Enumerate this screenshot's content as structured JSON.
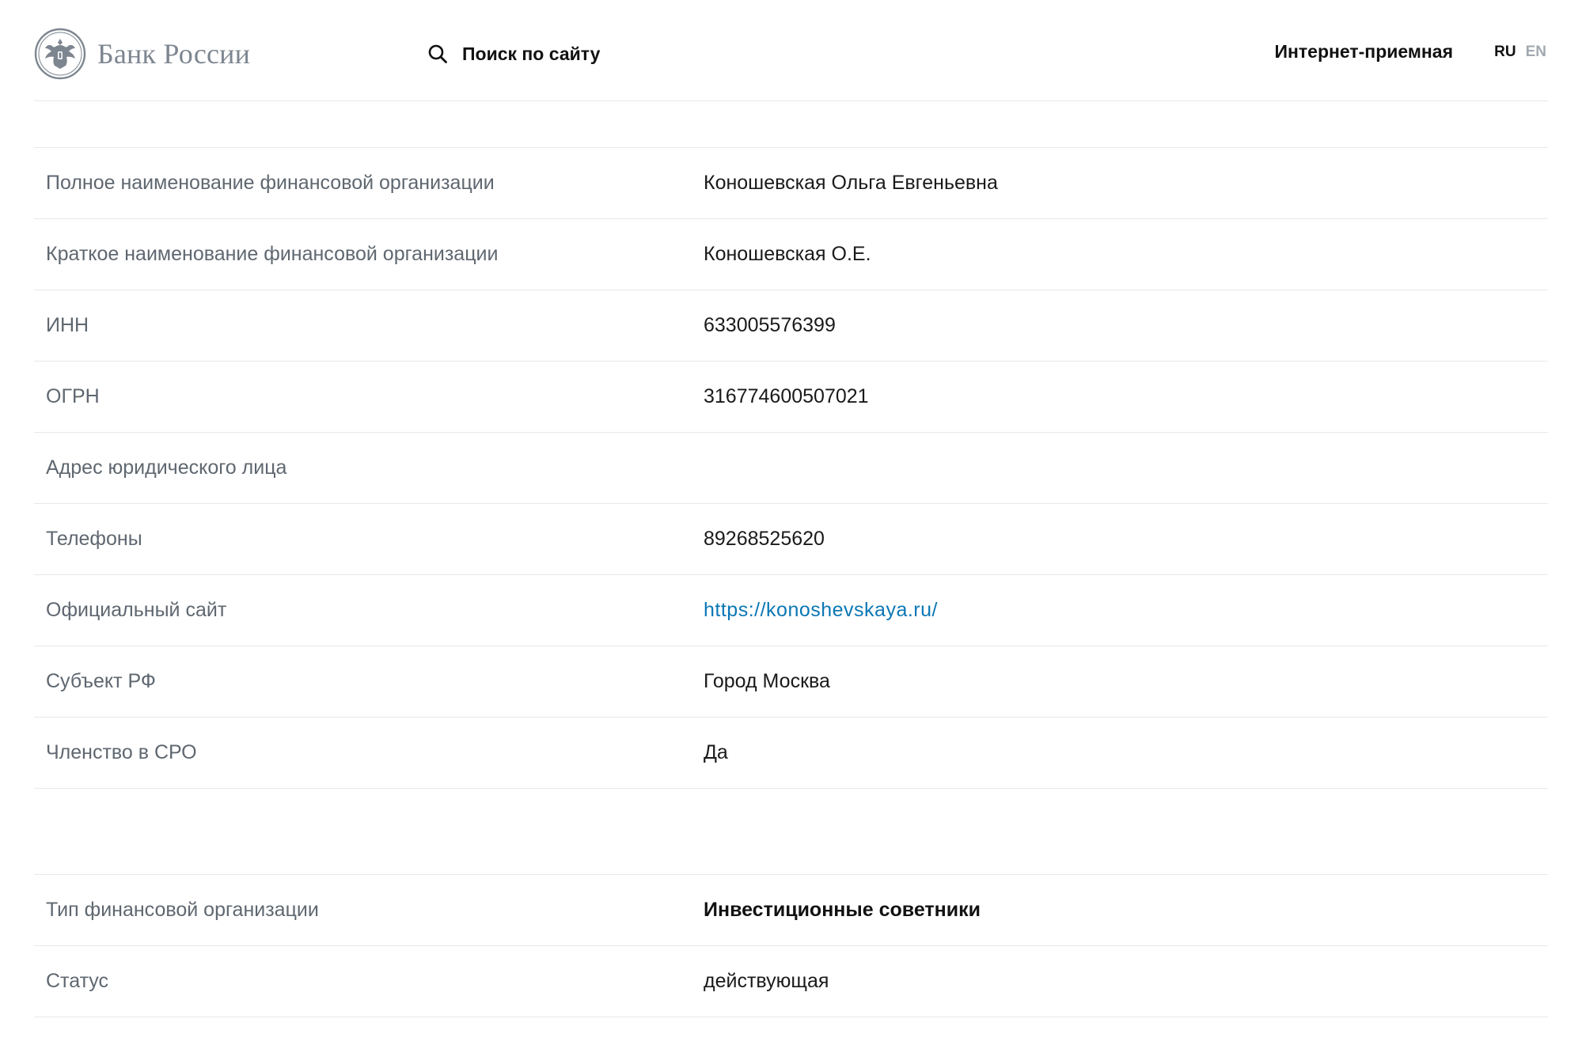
{
  "header": {
    "logo_text": "Банк России",
    "search_label": "Поиск по сайту",
    "reception_label": "Интернет-приемная",
    "lang_ru": "RU",
    "lang_en": "EN"
  },
  "details": [
    {
      "label": "Полное наименование финансовой организации",
      "value": "Коношевская Ольга Евгеньевна"
    },
    {
      "label": "Краткое наименование финансовой организации",
      "value": "Коношевская О.Е."
    },
    {
      "label": "ИНН",
      "value": "633005576399"
    },
    {
      "label": "ОГРН",
      "value": "316774600507021"
    },
    {
      "label": "Адрес юридического лица",
      "value": ""
    },
    {
      "label": "Телефоны",
      "value": "89268525620"
    },
    {
      "label": "Официальный сайт",
      "value": "https://konoshevskaya.ru/"
    },
    {
      "label": "Субъект РФ",
      "value": "Город Москва"
    },
    {
      "label": "Членство в СРО",
      "value": "Да"
    }
  ],
  "status_block": [
    {
      "label": "Тип финансовой организации",
      "value": "Инвестиционные советники"
    },
    {
      "label": "Статус",
      "value": "действующая"
    }
  ],
  "colors": {
    "link": "#0b77b5",
    "label_text": "#5f6770",
    "divider": "#e6e8eb",
    "logo_grey": "#7d8690"
  },
  "icons": {
    "logo": "double-headed-eagle-emblem-icon",
    "search": "search-icon"
  }
}
